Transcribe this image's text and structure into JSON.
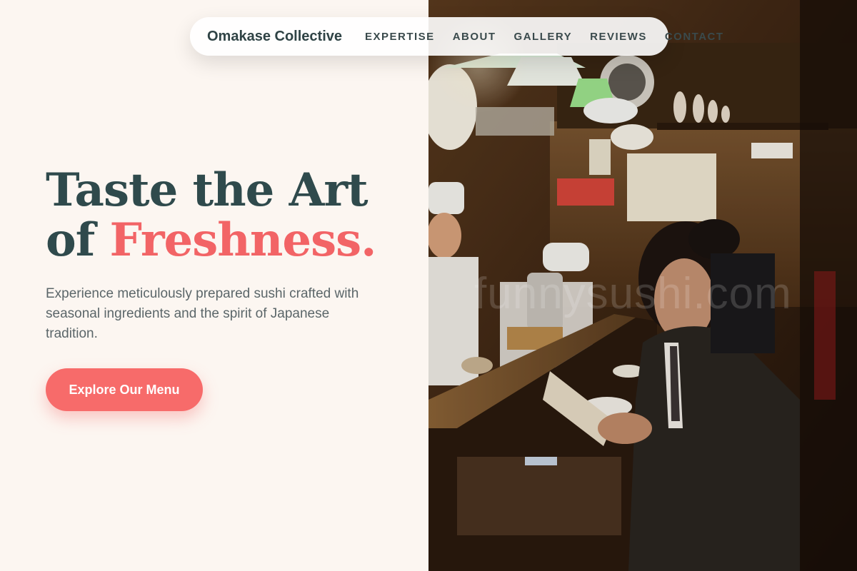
{
  "nav": {
    "brand": "Omakase Collective",
    "links": [
      "EXPERTISE",
      "ABOUT",
      "GALLERY",
      "REVIEWS",
      "CONTACT"
    ]
  },
  "hero": {
    "title_line1": "Taste the Art",
    "title_of": "of",
    "title_accent": "Freshness.",
    "description": "Experience meticulously prepared sushi crafted with seasonal ingredients and the spirit of Japanese tradition.",
    "cta_label": "Explore Our Menu"
  },
  "image": {
    "watermark": "funnysushi.com"
  },
  "colors": {
    "background": "#fcf6f1",
    "heading": "#2f4a4c",
    "accent": "#f26466",
    "button": "#f76b6a",
    "body_text": "#5b6669"
  }
}
